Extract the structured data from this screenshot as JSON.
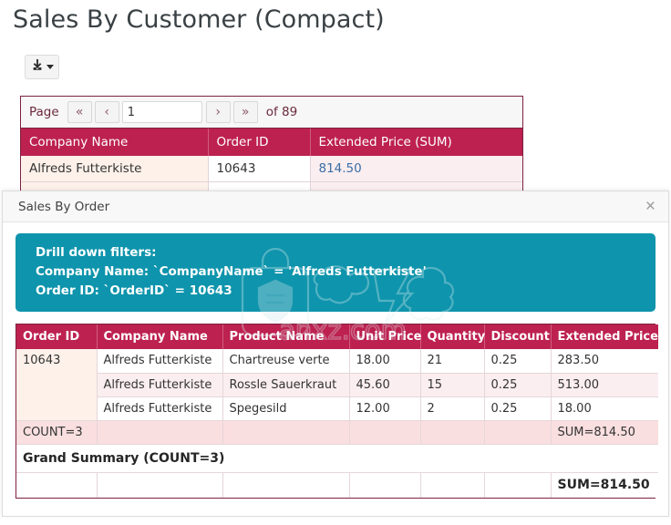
{
  "page": {
    "title": "Sales By Customer (Compact)"
  },
  "toolbar": {
    "export_icon": "download-icon",
    "export_caret": "caret-down-icon"
  },
  "main_grid": {
    "pager": {
      "label": "Page",
      "first_label": "«",
      "prev_label": "‹",
      "value": "1",
      "placeholder": "",
      "next_label": "›",
      "last_label": "»",
      "of_label": "of 89"
    },
    "columns": [
      "Company Name",
      "Order ID",
      "Extended Price (SUM)"
    ],
    "rows": [
      {
        "company": "Alfreds Futterkiste",
        "order_id": "10643",
        "extended_price": "814.50"
      }
    ]
  },
  "modal": {
    "title": "Sales By Order",
    "close_label": "×",
    "alert": {
      "line1": "Drill down filters:",
      "line2": "Company Name: `CompanyName` = 'Alfreds Futterkiste'",
      "line3": "Order ID: `OrderID` = 10643"
    },
    "watermark": {
      "text": "anxz.com",
      "icon": "shield-bag-watermark-icon"
    },
    "detail_table": {
      "columns": [
        "Order ID",
        "Company Name",
        "Product Name",
        "Unit Price",
        "Quantity",
        "Discount",
        "Extended Price"
      ],
      "order_id": "10643",
      "rows": [
        {
          "company": "Alfreds Futterkiste",
          "product": "Chartreuse verte",
          "unit_price": "18.00",
          "quantity": "21",
          "discount": "0.25",
          "extended_price": "283.50"
        },
        {
          "company": "Alfreds Futterkiste",
          "product": "Rossle Sauerkraut",
          "unit_price": "45.60",
          "quantity": "15",
          "discount": "0.25",
          "extended_price": "513.00"
        },
        {
          "company": "Alfreds Futterkiste",
          "product": "Spegesild",
          "unit_price": "12.00",
          "quantity": "2",
          "discount": "0.25",
          "extended_price": "18.00"
        }
      ],
      "group_summary": {
        "count_label": "COUNT=3",
        "sum_label": "SUM=814.50"
      },
      "grand_summary": {
        "title": "Grand Summary (COUNT=3)",
        "sum_label": "SUM=814.50"
      }
    }
  },
  "colors": {
    "header_crimson": "#bd2150",
    "alert_teal": "#0e94ac",
    "link_blue": "#3a6ea5",
    "summary_pink": "#fadfe0",
    "row_pink": "#fbeef0",
    "orderid_peach": "#fdf1ea",
    "border_maroon": "#7d2240"
  }
}
